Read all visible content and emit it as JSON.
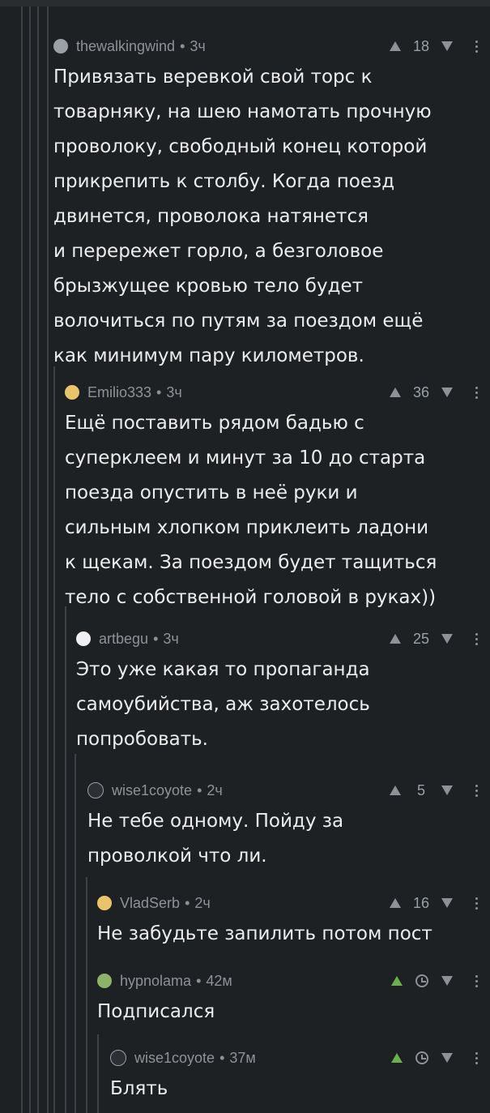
{
  "comments": [
    {
      "author": "thewalkingwind",
      "time": "3ч",
      "score": "18",
      "text": "Привязать веревкой свой торс к\nтоварняку, на шею намотать прочную\nпроволоку, свободный конец которой\nприкрепить к столбу. Когда поезд\nдвинется, проволока натянется\nи перережет горло, а безголовое\nбрызжущее кровью тело будет\nволочиться по путям за поездом ещё\nкак минимум пару километров.",
      "avatar": "grey-avatar-icon"
    },
    {
      "author": "Emilio333",
      "time": "3ч",
      "score": "36",
      "text": "Ещё поставить рядом бадью с\nсуперклеем и минут за 10 до старта\nпоезда опустить в неё руки и\nсильным хлопком приклеить ладони\nк щекам. За поездом будет тащиться\nтело с собственной головой в руках))",
      "avatar": "yellow-avatar-icon"
    },
    {
      "author": "artbegu",
      "time": "3ч",
      "score": "25",
      "text": "Это уже какая то пропаганда\nсамоубийства, аж захотелось\nпопробовать.",
      "avatar": "white-avatar-icon"
    },
    {
      "author": "wise1coyote",
      "time": "2ч",
      "score": "5",
      "text": "Не тебе одному. Пойду за\nпроволкой что ли.",
      "avatar": "dark-avatar-icon"
    },
    {
      "author": "VladSerb",
      "time": "2ч",
      "score": "16",
      "text": "Не забудьте запилить потом пост",
      "avatar": "yellow-avatar-icon"
    },
    {
      "author": "hypnolama",
      "time": "42м",
      "score": "",
      "text": "Подписался",
      "avatar": "green-avatar-icon"
    },
    {
      "author": "wise1coyote",
      "time": "37м",
      "score": "",
      "text": "Блять",
      "avatar": "dark-avatar-icon"
    }
  ],
  "separator": "•"
}
